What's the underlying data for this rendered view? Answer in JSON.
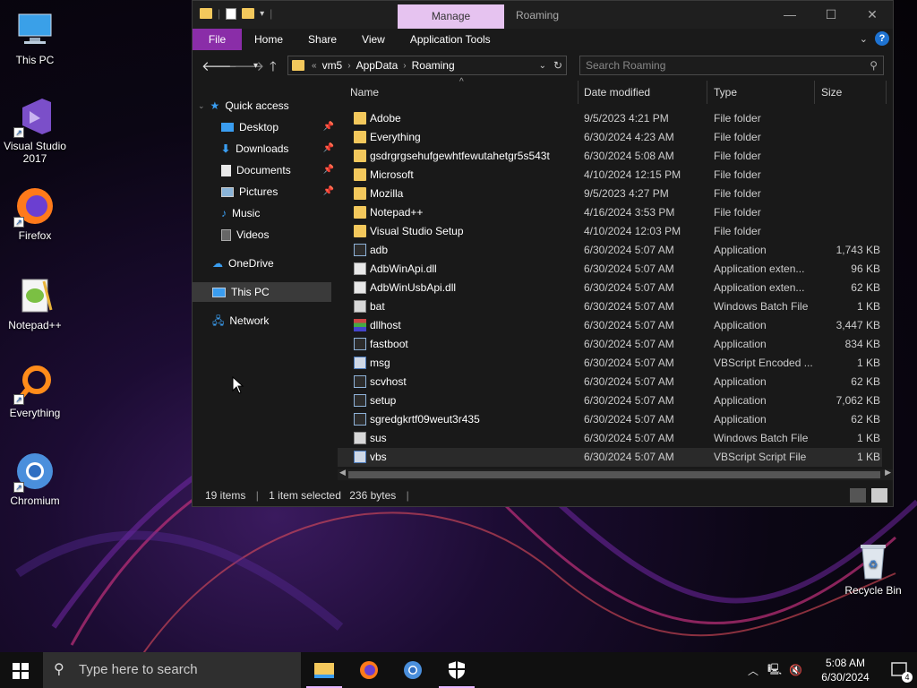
{
  "desktop": {
    "icons": [
      {
        "label": "This PC"
      },
      {
        "label": "Visual Studio 2017"
      },
      {
        "label": "Firefox"
      },
      {
        "label": "Notepad++"
      },
      {
        "label": "Everything"
      },
      {
        "label": "Chromium"
      },
      {
        "label": "Recycle Bin"
      }
    ]
  },
  "window": {
    "context_tab": "Manage",
    "title": "Roaming",
    "ribbon_tabs": [
      "File",
      "Home",
      "Share",
      "View",
      "Application Tools"
    ],
    "help_label": "?",
    "address": {
      "crumbs": [
        "vm5",
        "AppData",
        "Roaming"
      ],
      "overflow": "«"
    },
    "search_placeholder": "Search Roaming",
    "nav": {
      "quick_access": "Quick access",
      "quick_items": [
        "Desktop",
        "Downloads",
        "Documents",
        "Pictures",
        "Music",
        "Videos"
      ],
      "onedrive": "OneDrive",
      "this_pc": "This PC",
      "network": "Network"
    },
    "columns": [
      "Name",
      "Date modified",
      "Type",
      "Size"
    ],
    "files": [
      {
        "name": "Adobe",
        "date": "9/5/2023 4:21 PM",
        "type": "File folder",
        "size": "",
        "icon": "folder"
      },
      {
        "name": "Everything",
        "date": "6/30/2024 4:23 AM",
        "type": "File folder",
        "size": "",
        "icon": "folder"
      },
      {
        "name": "gsdrgrgsehufgewhtfewutahetgr5s543t",
        "date": "6/30/2024 5:08 AM",
        "type": "File folder",
        "size": "",
        "icon": "folder"
      },
      {
        "name": "Microsoft",
        "date": "4/10/2024 12:15 PM",
        "type": "File folder",
        "size": "",
        "icon": "folder"
      },
      {
        "name": "Mozilla",
        "date": "9/5/2023 4:27 PM",
        "type": "File folder",
        "size": "",
        "icon": "folder"
      },
      {
        "name": "Notepad++",
        "date": "4/16/2024 3:53 PM",
        "type": "File folder",
        "size": "",
        "icon": "folder"
      },
      {
        "name": "Visual Studio Setup",
        "date": "4/10/2024 12:03 PM",
        "type": "File folder",
        "size": "",
        "icon": "folder"
      },
      {
        "name": "adb",
        "date": "6/30/2024 5:07 AM",
        "type": "Application",
        "size": "1,743 KB",
        "icon": "app"
      },
      {
        "name": "AdbWinApi.dll",
        "date": "6/30/2024 5:07 AM",
        "type": "Application exten...",
        "size": "96 KB",
        "icon": "dll"
      },
      {
        "name": "AdbWinUsbApi.dll",
        "date": "6/30/2024 5:07 AM",
        "type": "Application exten...",
        "size": "62 KB",
        "icon": "dll"
      },
      {
        "name": "bat",
        "date": "6/30/2024 5:07 AM",
        "type": "Windows Batch File",
        "size": "1 KB",
        "icon": "bat"
      },
      {
        "name": "dllhost",
        "date": "6/30/2024 5:07 AM",
        "type": "Application",
        "size": "3,447 KB",
        "icon": "rar"
      },
      {
        "name": "fastboot",
        "date": "6/30/2024 5:07 AM",
        "type": "Application",
        "size": "834 KB",
        "icon": "app"
      },
      {
        "name": "msg",
        "date": "6/30/2024 5:07 AM",
        "type": "VBScript Encoded ...",
        "size": "1 KB",
        "icon": "vbs"
      },
      {
        "name": "scvhost",
        "date": "6/30/2024 5:07 AM",
        "type": "Application",
        "size": "62 KB",
        "icon": "app"
      },
      {
        "name": "setup",
        "date": "6/30/2024 5:07 AM",
        "type": "Application",
        "size": "7,062 KB",
        "icon": "app"
      },
      {
        "name": "sgredgkrtf09weut3r435",
        "date": "6/30/2024 5:07 AM",
        "type": "Application",
        "size": "62 KB",
        "icon": "app"
      },
      {
        "name": "sus",
        "date": "6/30/2024 5:07 AM",
        "type": "Windows Batch File",
        "size": "1 KB",
        "icon": "bat"
      },
      {
        "name": "vbs",
        "date": "6/30/2024 5:07 AM",
        "type": "VBScript Script File",
        "size": "1 KB",
        "icon": "vbs",
        "selected": true
      }
    ],
    "status": {
      "items": "19 items",
      "selected": "1 item selected",
      "bytes": "236 bytes"
    }
  },
  "taskbar": {
    "search_placeholder": "Type here to search",
    "time": "5:08 AM",
    "date": "6/30/2024",
    "notification_count": "4"
  }
}
